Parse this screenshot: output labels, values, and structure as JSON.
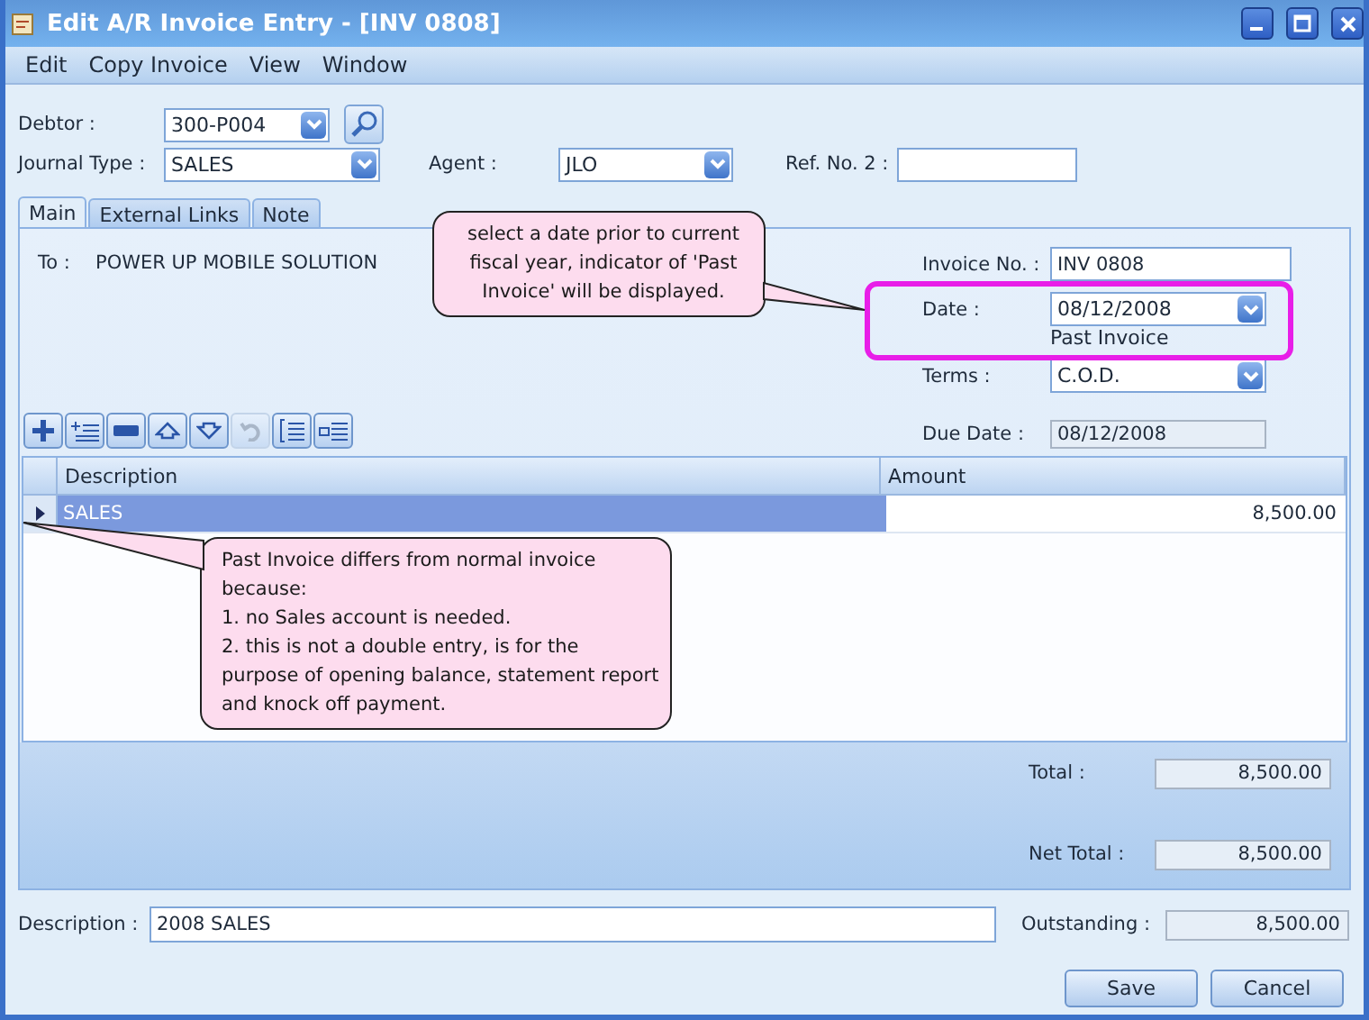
{
  "window": {
    "title": "Edit A/R Invoice Entry - [INV 0808]"
  },
  "menu": [
    {
      "label": "Edit"
    },
    {
      "label": "Copy Invoice"
    },
    {
      "label": "View"
    },
    {
      "label": "Window"
    }
  ],
  "header": {
    "debtor_label": "Debtor :",
    "debtor": "300-P004",
    "journal_label": "Journal Type :",
    "journal": "SALES",
    "agent_label": "Agent :",
    "agent": "JLO",
    "ref_label": "Ref. No. 2 :"
  },
  "tabs": [
    {
      "label": "Main",
      "selected": true
    },
    {
      "label": "External Links",
      "selected": false
    },
    {
      "label": "Note",
      "selected": false
    }
  ],
  "to": {
    "label": "To :",
    "value": "POWER UP MOBILE SOLUTION"
  },
  "invoice": {
    "number_label": "Invoice No. :",
    "number": "INV 0808",
    "date_label": "Date :",
    "date": "08/12/2008",
    "indicator": "Past Invoice",
    "terms_label": "Terms :",
    "terms": "C.O.D.",
    "due_label": "Due Date :",
    "due": "08/12/2008"
  },
  "toolbar": [
    {
      "kind": "add",
      "disabled": false
    },
    {
      "kind": "insert",
      "disabled": false
    },
    {
      "kind": "remove",
      "disabled": false
    },
    {
      "kind": "up",
      "disabled": false
    },
    {
      "kind": "down",
      "disabled": false
    },
    {
      "kind": "undo",
      "disabled": true
    },
    {
      "kind": "list",
      "disabled": false
    },
    {
      "kind": "detail",
      "disabled": false
    }
  ],
  "table": {
    "columns": [
      "Description",
      "Amount"
    ],
    "rows": [
      {
        "cells": [
          "SALES",
          "8,500.00"
        ],
        "selected": true
      }
    ]
  },
  "totals": {
    "total_label": "Total :",
    "total": "8,500.00",
    "net_label": "Net Total :",
    "net": "8,500.00"
  },
  "footer": {
    "description_label": "Description :",
    "description": "2008 SALES",
    "outstanding_label": "Outstanding :",
    "outstanding": "8,500.00"
  },
  "buttons": [
    "Save",
    "Cancel"
  ],
  "callouts": [
    {
      "text": "select a date prior to current fiscal year, indicator of 'Past Invoice' will be displayed."
    },
    {
      "text": "Past Invoice differs from normal invoice because:\n1. no Sales account is needed.\n2. this is not a double entry, is for the purpose of opening balance, statement report and knock off payment."
    }
  ]
}
